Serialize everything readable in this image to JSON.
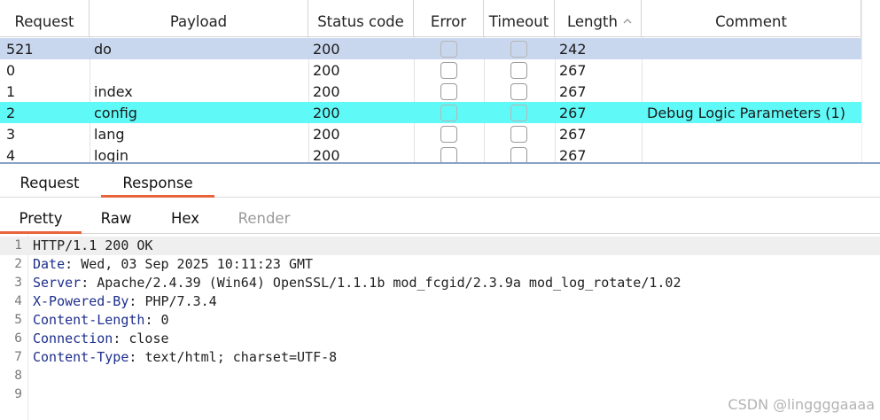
{
  "results_table": {
    "columns": {
      "request": "Request",
      "payload": "Payload",
      "status": "Status code",
      "error": "Error",
      "timeout": "Timeout",
      "length": "Length",
      "comment": "Comment"
    },
    "sort": {
      "column": "length",
      "direction": "ascending"
    },
    "rows": [
      {
        "request": "521",
        "payload": "do",
        "status": "200",
        "length": "242",
        "comment": "",
        "error": false,
        "timeout": false,
        "state": "selected"
      },
      {
        "request": "0",
        "payload": "",
        "status": "200",
        "length": "267",
        "comment": "",
        "error": false,
        "timeout": false,
        "state": "normal"
      },
      {
        "request": "1",
        "payload": "index",
        "status": "200",
        "length": "267",
        "comment": "",
        "error": false,
        "timeout": false,
        "state": "normal"
      },
      {
        "request": "2",
        "payload": "config",
        "status": "200",
        "length": "267",
        "comment": "Debug Logic Parameters (1)",
        "error": false,
        "timeout": false,
        "state": "highlighted"
      },
      {
        "request": "3",
        "payload": "lang",
        "status": "200",
        "length": "267",
        "comment": "",
        "error": false,
        "timeout": false,
        "state": "normal"
      },
      {
        "request": "4",
        "payload": "login",
        "status": "200",
        "length": "267",
        "comment": "",
        "error": false,
        "timeout": false,
        "state": "normal"
      }
    ],
    "colors": {
      "selected_row": "#c9d7ee",
      "highlight_row": "#5ffaf8"
    }
  },
  "message_tabs": [
    {
      "label": "Request",
      "active": false
    },
    {
      "label": "Response",
      "active": true
    }
  ],
  "view_tabs": [
    {
      "label": "Pretty",
      "active": true,
      "enabled": true
    },
    {
      "label": "Raw",
      "active": false,
      "enabled": true
    },
    {
      "label": "Hex",
      "active": false,
      "enabled": true
    },
    {
      "label": "Render",
      "active": false,
      "enabled": false
    }
  ],
  "response": {
    "lines": [
      {
        "num": "1",
        "text": "HTTP/1.1 200 OK"
      },
      {
        "num": "2",
        "key": "Date",
        "value": "Wed, 03 Sep 2025 10:11:23 GMT"
      },
      {
        "num": "3",
        "key": "Server",
        "value": "Apache/2.4.39 (Win64) OpenSSL/1.1.1b mod_fcgid/2.3.9a mod_log_rotate/1.02"
      },
      {
        "num": "4",
        "key": "X-Powered-By",
        "value": "PHP/7.3.4"
      },
      {
        "num": "5",
        "key": "Content-Length",
        "value": "0"
      },
      {
        "num": "6",
        "key": "Connection",
        "value": "close"
      },
      {
        "num": "7",
        "key": "Content-Type",
        "value": "text/html; charset=UTF-8"
      },
      {
        "num": "8",
        "text": ""
      },
      {
        "num": "9",
        "text": ""
      }
    ],
    "colors": {
      "header_name": "#1e2f8c",
      "tab_underline": "#e8643c"
    }
  },
  "watermark": "CSDN @linggggaaaa"
}
